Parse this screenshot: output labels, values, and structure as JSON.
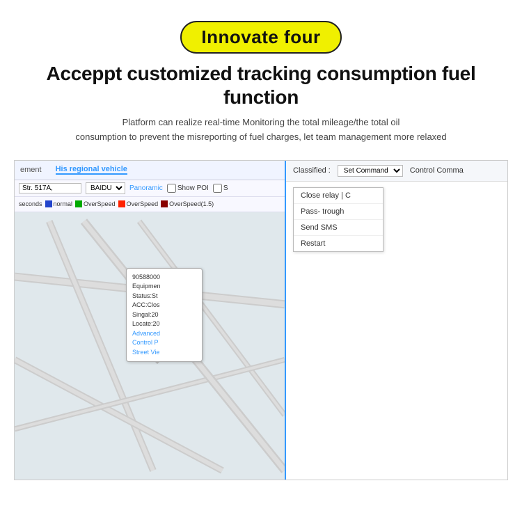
{
  "badge": {
    "text": "Innovate four"
  },
  "header": {
    "title": "Acceppt customized tracking consumption fuel function",
    "subtitle_line1": "Platform can realize real-time Monitoring  the total mileage/the total oil",
    "subtitle_line2": "consumption to prevent the misreporting of fuel charges, let team management more relaxed"
  },
  "left_panel": {
    "tabs": [
      {
        "label": "ement",
        "active": false
      },
      {
        "label": "His regional vehicle",
        "active": true
      }
    ],
    "controls": {
      "address": "Str. 517A,",
      "map_type": "BAIDU",
      "panoramic": "Panoramic",
      "show_poi": "Show POI",
      "show_s": "S"
    },
    "legend": {
      "prefix": "seconds",
      "items": [
        {
          "label": "normal",
          "color": "#0000ff"
        },
        {
          "label": "OverSpeed",
          "color": "#00aa00"
        },
        {
          "label": "OverSpeed",
          "color": "#ff0000"
        },
        {
          "label": "OverSpeed(1.5)",
          "color": "#cc0000"
        }
      ]
    },
    "popup": {
      "id": "90588000",
      "equipment": "Equipmen",
      "status": "Status:St",
      "acc": "ACC:Clos",
      "signal": "Singal:20",
      "locate": "Locate:20",
      "advanced": "Advanced",
      "control": "Control P",
      "street": "Street Vie"
    }
  },
  "right_panel": {
    "classified_label": "Classified :",
    "set_command_label": "Set Command",
    "control_command_label": "Control Comma",
    "menu_items": [
      {
        "label": "Close relay | C"
      },
      {
        "label": "Pass- trough"
      },
      {
        "label": "Send SMS"
      },
      {
        "label": "Restart"
      }
    ]
  }
}
